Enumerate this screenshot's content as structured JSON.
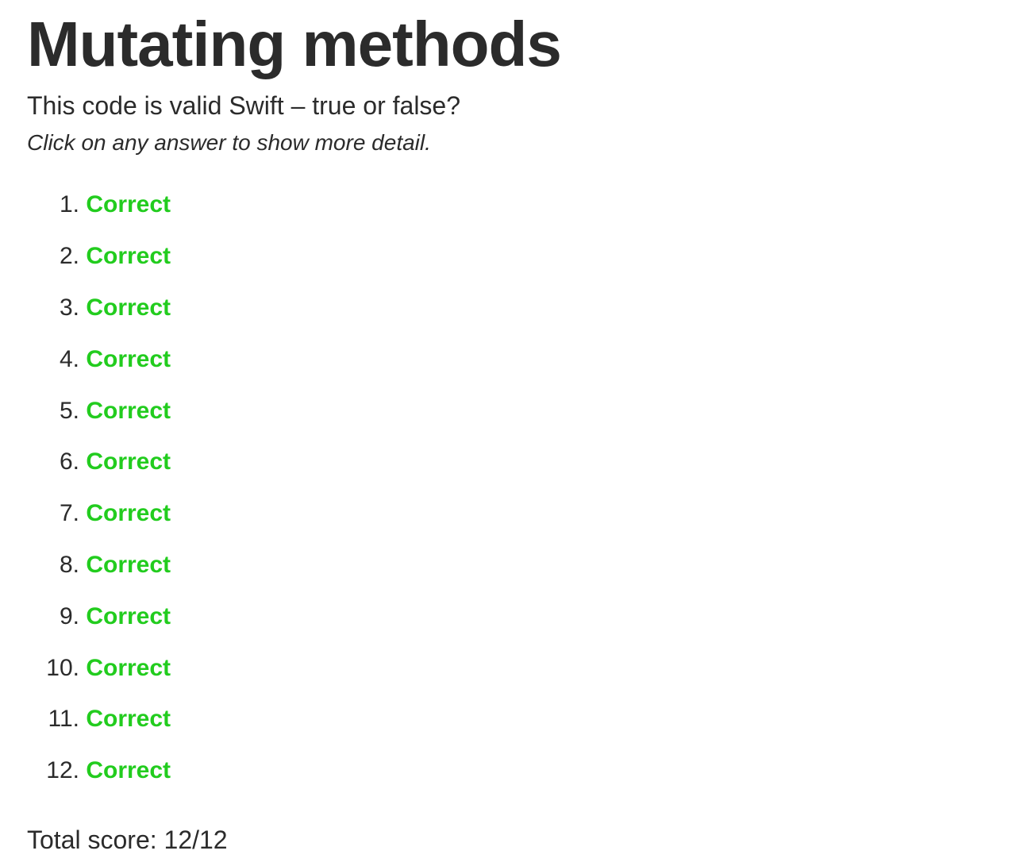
{
  "page": {
    "title": "Mutating methods",
    "subtitle": "This code is valid Swift – true or false?",
    "hint": "Click on any answer to show more detail."
  },
  "answers": [
    {
      "number": "1.",
      "label": "Correct"
    },
    {
      "number": "2.",
      "label": "Correct"
    },
    {
      "number": "3.",
      "label": "Correct"
    },
    {
      "number": "4.",
      "label": "Correct"
    },
    {
      "number": "5.",
      "label": "Correct"
    },
    {
      "number": "6.",
      "label": "Correct"
    },
    {
      "number": "7.",
      "label": "Correct"
    },
    {
      "number": "8.",
      "label": "Correct"
    },
    {
      "number": "9.",
      "label": "Correct"
    },
    {
      "number": "10.",
      "label": "Correct"
    },
    {
      "number": "11.",
      "label": "Correct"
    },
    {
      "number": "12.",
      "label": "Correct"
    }
  ],
  "score": {
    "text": "Total score: 12/12"
  },
  "colors": {
    "correct": "#22cc1e",
    "text": "#2b2b2b"
  }
}
